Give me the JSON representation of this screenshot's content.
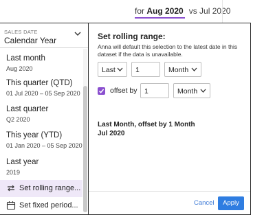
{
  "compare": {
    "prefix": "for",
    "period": "Aug 2020",
    "vs_label": "vs Jul 2020"
  },
  "selector": {
    "caption": "SALES DATE",
    "value": "Calendar Year"
  },
  "options": [
    {
      "title": "Last month",
      "subtitle": "Aug 2020"
    },
    {
      "title": "This quarter (QTD)",
      "subtitle": "01 Jul 2020 – 05 Sep 2020"
    },
    {
      "title": "Last quarter",
      "subtitle": "Q2 2020"
    },
    {
      "title": "This year (YTD)",
      "subtitle": "01 Jan 2020 – 05 Sep 2020"
    },
    {
      "title": "Last year",
      "subtitle": "2019"
    }
  ],
  "actions": {
    "rolling": {
      "label": "Set rolling range...",
      "icon": "rolling-arrows-icon"
    },
    "fixed": {
      "label": "Set fixed period...",
      "icon": "calendar-icon"
    }
  },
  "rolling": {
    "title": "Set rolling range:",
    "description": "Anna will default this selection to the latest date in this dataset if the data is unavailable.",
    "direction": "Last",
    "count": "1",
    "unit": "Month",
    "offset_label": "offset by",
    "offset_checked": true,
    "offset_count": "1",
    "offset_unit": "Month",
    "summary_line1": "Last Month, offset by 1 Month",
    "summary_line2": "Jul 2020"
  },
  "buttons": {
    "cancel": "Cancel",
    "apply": "Apply"
  },
  "colors": {
    "accent": "#8a4fcf",
    "highlight": "#efe8f8",
    "primary": "#2f7de1",
    "link": "#3d7ad6"
  }
}
